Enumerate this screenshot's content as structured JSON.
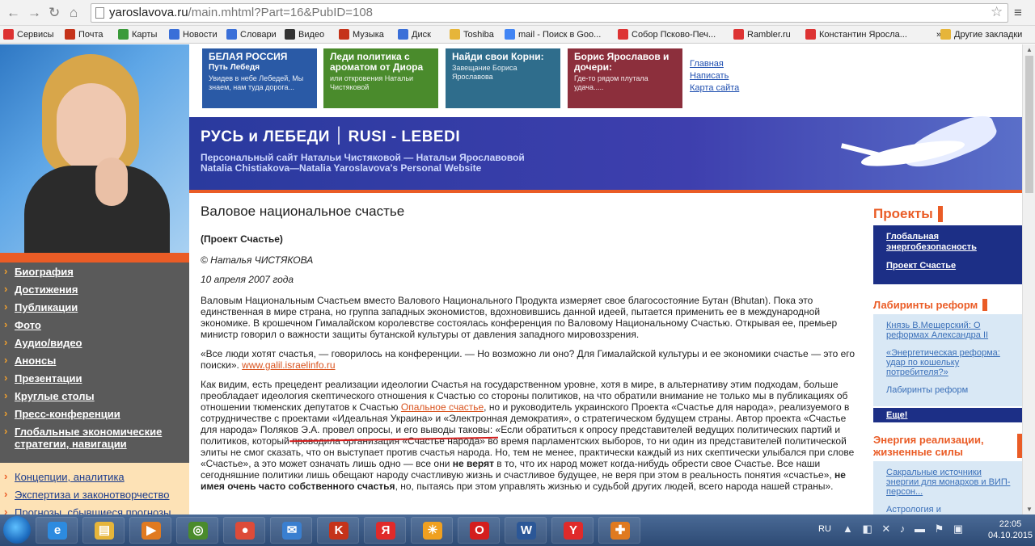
{
  "browser": {
    "url_host": "yaroslavova.ru",
    "url_path": "/main.mhtml?Part=16&PubID=108",
    "bookmarks": [
      {
        "label": "Сервисы",
        "color": "#d33"
      },
      {
        "label": "Почта",
        "color": "#c5331a"
      },
      {
        "label": "Карты",
        "color": "#3a9a3a"
      },
      {
        "label": "Новости",
        "color": "#3a6fd8"
      },
      {
        "label": "Словари",
        "color": "#3a6fd8"
      },
      {
        "label": "Видео",
        "color": "#333"
      },
      {
        "label": "Музыка",
        "color": "#c5331a"
      },
      {
        "label": "Диск",
        "color": "#3a6fd8"
      },
      {
        "label": "Toshiba",
        "color": "#e6b53a"
      },
      {
        "label": "mail - Поиск в Goo...",
        "color": "#4285f4"
      },
      {
        "label": "Собор Псково-Печ...",
        "color": "#d33"
      },
      {
        "label": "Rambler.ru",
        "color": "#d33"
      },
      {
        "label": "Константин Яросла...",
        "color": "#d33"
      },
      {
        "label": "»",
        "color": "#f2f2f2"
      },
      {
        "label": "Другие закладки",
        "color": "#e6b53a"
      }
    ]
  },
  "banners": [
    {
      "title": "БЕЛАЯ РОССИЯ",
      "subtitle": "Путь Лебедя",
      "text": "Увидев в небе Лебедей, Мы знаем, нам туда дорога..."
    },
    {
      "title": "Леди политика с ароматом от Диора",
      "subtitle": "",
      "text": "или откровения Натальи Чистяковой"
    },
    {
      "title": "Найди свои Корни:",
      "subtitle": "",
      "text": "Завещание Бориса Ярославова"
    },
    {
      "title": "Борис Ярославов и дочери:",
      "subtitle": "",
      "text": "Где-то рядом плутала удача....."
    }
  ],
  "top_links": [
    "Главная",
    "Написать",
    "Карта сайта"
  ],
  "hero": {
    "title": "РУСЬ и ЛЕБЕДИ ׀ RUSI - LEBEDI",
    "sub1": "Персональный сайт Натальи Чистяковой — Натальи Ярославовой",
    "sub2": "Natalia Chistiakova—Natalia Yaroslavova's  Personal Website"
  },
  "nav": [
    "Биография",
    "Достижения",
    "Публикации",
    "Фото",
    "Аудио/видео",
    "Анонсы",
    "Презентации",
    "Круглые столы",
    "Пресс-конференции",
    "Глобальные экономические стратегии, навигации"
  ],
  "nav2": [
    "Концепции, аналитика",
    "Экспертиза и законотворчество",
    "Прогнозы, сбывшиеся прогнозы"
  ],
  "article": {
    "title": "Валовое национальное счастье",
    "project": "(Проект Счастье)",
    "author": "© Наталья ЧИСТЯКОВА",
    "date": "10 апреля 2007 года",
    "p1": "Валовым Национальным Счастьем вместо Валового Национального Продукта измеряет свое благосостояние Бутан (Bhutan). Пока это единственная в мире страна, но группа западных экономистов, вдохновившись данной идеей, пытается применить ее в международной экономике. В крошечном Гималайском королевстве состоялась конференция по Валовому Национальному Счастью. Открывая ее, премьер министр говорил о важности защиты бутанской культуры от давления западного мировоззрения.",
    "p2": "«Все люди хотят счастья, — говорилось на конференции. — Но возможно ли оно? Для Гималайской культуры и ее экономики счастье — это его поиски». ",
    "p2_link": "www.galil.israelinfo.ru",
    "p3a": "Как видим, есть прецедент реализации идеологии Счастья на государственном уровне, хотя в мире, в альтернативу этим подходам, больше преобладает идеология скептического отношения к Счастью со стороны политиков, на что обратили внимание не только мы в публикациях об отношении тюменских депутатов к Счастью ",
    "p3_link": "Опальное счастье",
    "p3b": ", но и руководитель украинского Проекта «Счастье для народа», реализуемого в сотрудничестве с проектами «Идеальная Украина» и «Электронная демократия», о стратегическом будущем страны. Автор проекта «Счастье для народа» Поляков Э.А. провел опросы, и его выводы таковы: «Если обратиться к опросу представителей ведущих политических партий и политиков, который проводила организация «Счастье народа» во время парламентских выборов, то ни один из представителей политической элиты не смог сказать, что он выступает против счастья народа. Но, тем не менее, практически каждый из них скептически улыбался при слове «Счастье», а это может означать лишь одно — все они ",
    "p3_bold1": "не верят",
    "p3c": " в то, что их народ может когда-нибудь обрести свое Счастье. Все наши сегодняшние политики лишь обещают народу счастливую жизнь и счастливое будущее, не веря при этом в реальность понятия «счастье», ",
    "p3_bold2": "не имея очень часто собственного счастья",
    "p3d": ", но, пытаясь при этом управлять жизнью и судьбой других людей, всего народа нашей страны»."
  },
  "right": {
    "projects_head": "Проекты",
    "projects": [
      "Глобальная энергобезопасность",
      "Проект Счастье"
    ],
    "labyrinth_head": "Лабиринты реформ",
    "labyrinth": [
      "Князь В.Мещерский: О реформах Александра II",
      "«Энергетическая реформа: удар по кошельку потребителя?»",
      "Лабиринты реформ"
    ],
    "more": "Еще!",
    "energy_head": "Энергия реализации, жизненные силы",
    "energy": [
      "Сакральные источники энергии для монархов и ВИП-персон...",
      "Астрология и"
    ]
  },
  "taskbar": {
    "apps": [
      {
        "name": "ie",
        "glyph": "e",
        "color": "#2d8be0"
      },
      {
        "name": "explorer",
        "glyph": "▤",
        "color": "#e6b53a"
      },
      {
        "name": "media",
        "glyph": "▶",
        "color": "#e07a20"
      },
      {
        "name": "app4",
        "glyph": "◎",
        "color": "#4a8b2c"
      },
      {
        "name": "chrome",
        "glyph": "●",
        "color": "#dd4b39"
      },
      {
        "name": "mail",
        "glyph": "✉",
        "color": "#3a7fd0"
      },
      {
        "name": "kaspersky",
        "glyph": "K",
        "color": "#c5331a"
      },
      {
        "name": "yandex",
        "glyph": "Я",
        "color": "#e02a2a"
      },
      {
        "name": "app9",
        "glyph": "☀",
        "color": "#f0a020"
      },
      {
        "name": "opera",
        "glyph": "O",
        "color": "#d41e1e"
      },
      {
        "name": "word",
        "glyph": "W",
        "color": "#2b5797"
      },
      {
        "name": "yabrowser",
        "glyph": "Y",
        "color": "#e02a2a"
      },
      {
        "name": "app13",
        "glyph": "✚",
        "color": "#e07a20"
      }
    ],
    "lang": "RU",
    "time": "22:05",
    "date": "04.10.2015"
  }
}
